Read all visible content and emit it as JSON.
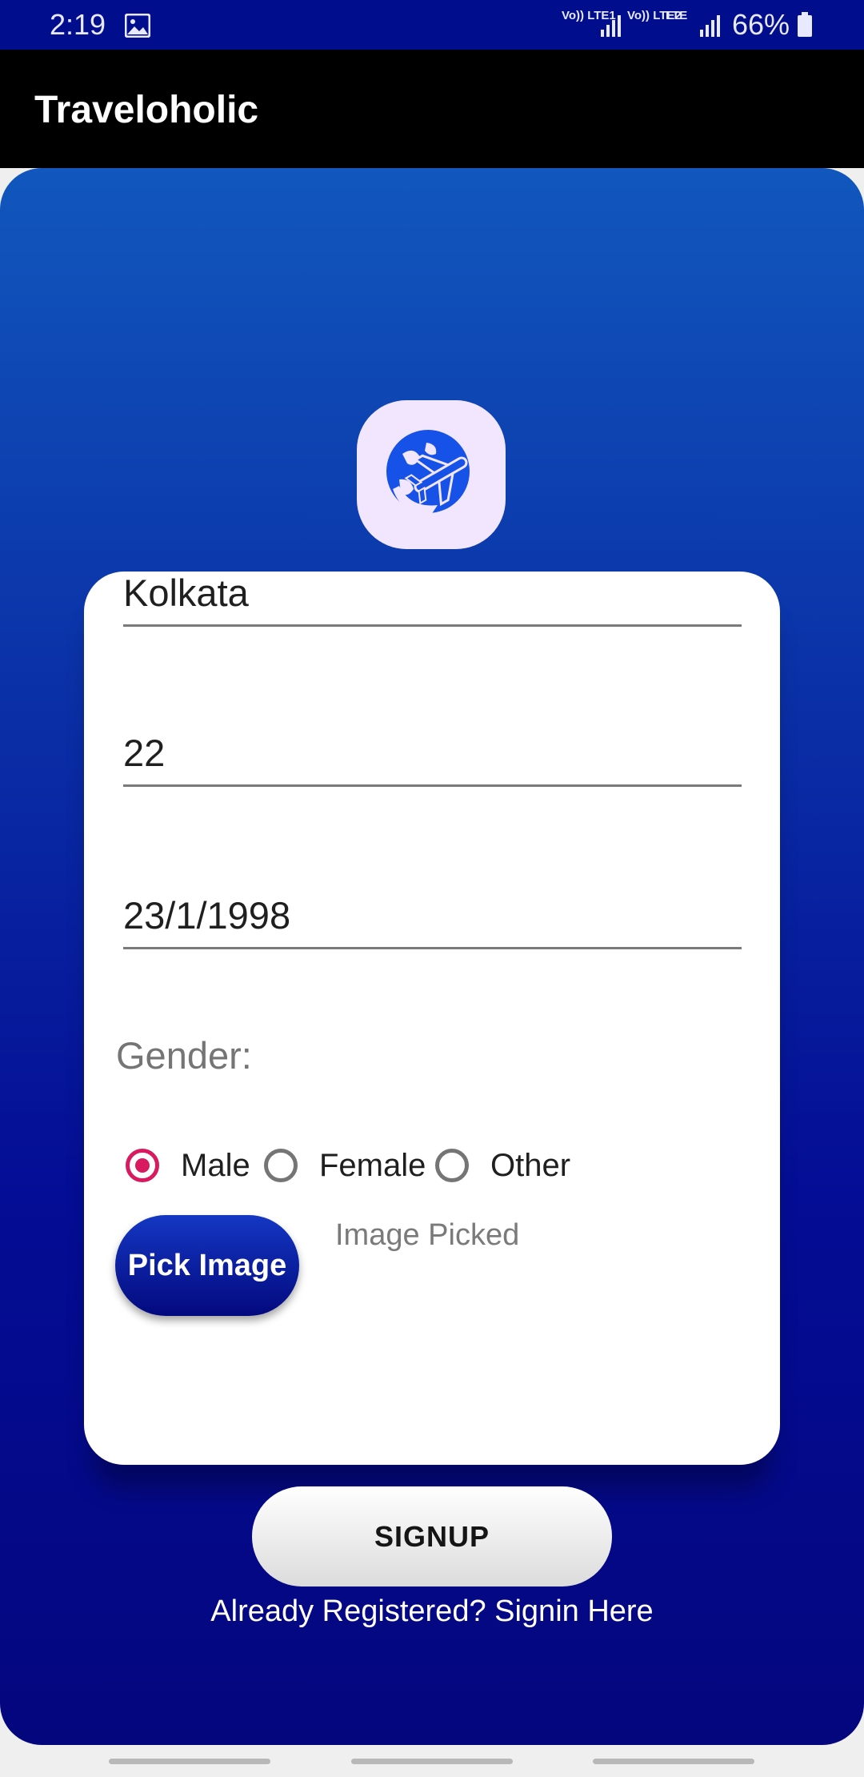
{
  "status_bar": {
    "time": "2:19",
    "net1": "Vo)) LTE1",
    "net2": "Vo)) LTE2",
    "net3": "LTE",
    "battery": "66%"
  },
  "app_bar": {
    "title": "Traveloholic"
  },
  "form": {
    "city": "Kolkata",
    "age": "22",
    "dob": "23/1/1998",
    "gender_label": "Gender:",
    "gender_options": [
      "Male",
      "Female",
      "Other"
    ],
    "gender_selected": "Male",
    "pick_image_label": "Pick Image",
    "image_status": "Image Picked"
  },
  "actions": {
    "signup_label": "SIGNUP",
    "signin_link": "Already Registered? Signin Here"
  },
  "colors": {
    "status_bar": "#000d8c",
    "accent_radio": "#d81b60",
    "gradient_top": "#1157bd",
    "gradient_bottom": "#04067e"
  },
  "icons": {
    "logo": "globe-airplane-icon",
    "gallery": "gallery-icon",
    "signal": "signal-bars-icon",
    "battery": "battery-icon"
  }
}
